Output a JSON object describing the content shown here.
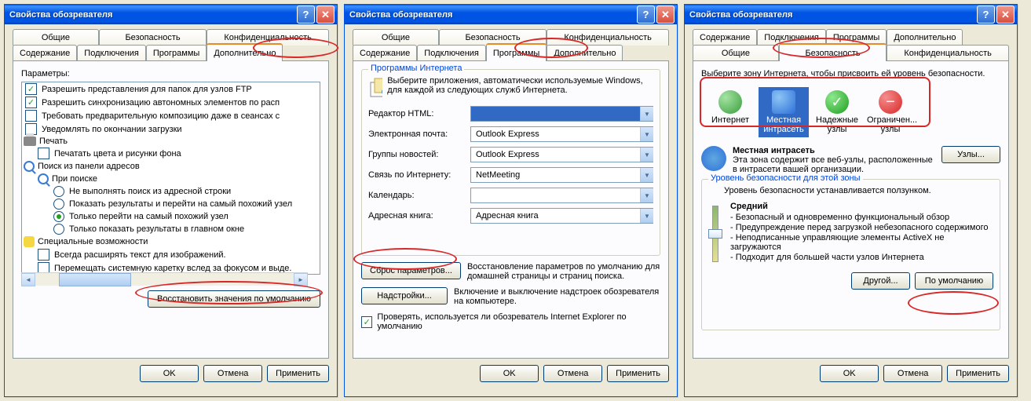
{
  "title": "Свойства обозревателя",
  "tabs": {
    "general": "Общие",
    "security": "Безопасность",
    "privacy": "Конфиденциальность",
    "content": "Содержание",
    "connections": "Подключения",
    "programs": "Программы",
    "advanced": "Дополнительно"
  },
  "buttons": {
    "ok": "OK",
    "cancel": "Отмена",
    "apply": "Применить",
    "restore": "Восстановить значения по умолчанию",
    "reset": "Сброс параметров...",
    "addons": "Надстройки...",
    "sites": "Узлы...",
    "custom": "Другой...",
    "default_level": "По умолчанию"
  },
  "adv": {
    "params_label": "Параметры:",
    "items": {
      "ftp": "Разрешить представления для папок для узлов FTP",
      "sync": "Разрешить синхронизацию автономных элементов по расп",
      "compose": "Требовать предварительную композицию даже в сеансах с",
      "notify": "Уведомлять по окончании загрузки",
      "print_h": "Печать",
      "print_bg": "Печатать цвета и рисунки фона",
      "search_h": "Поиск из панели адресов",
      "on_search": "При поиске",
      "no_search": "Не выполнять поиск из адресной строки",
      "show_goto": "Показать результаты и перейти на самый похожий узел",
      "goto_only": "Только перейти на самый похожий узел",
      "show_main": "Только показать результаты в главном окне",
      "acc_h": "Специальные возможности",
      "expand_alt": "Всегда расширять текст для изображений.",
      "caret": "Перемещать системную каретку вслед за фокусом и выде."
    }
  },
  "prog": {
    "group_title": "Программы Интернета",
    "desc": "Выберите приложения, автоматически используемые Windows, для каждой из следующих служб Интернета.",
    "fields": {
      "html": "Редактор HTML:",
      "mail": "Электронная почта:",
      "news": "Группы новостей:",
      "call": "Связь по Интернету:",
      "cal": "Календарь:",
      "addr": "Адресная книга:"
    },
    "values": {
      "html": "",
      "mail": "Outlook Express",
      "news": "Outlook Express",
      "call": "NetMeeting",
      "cal": "",
      "addr": "Адресная книга"
    },
    "reset_hint": "Восстановление параметров по умолчанию для домашней страницы и страниц поиска.",
    "addons_hint": "Включение и выключение надстроек обозревателя на компьютере.",
    "check_default": "Проверять, используется ли обозреватель Internet Explorer по умолчанию"
  },
  "sec": {
    "hint": "Выберите зону Интернета, чтобы присвоить ей уровень безопасности.",
    "zones": {
      "internet": "Интернет",
      "intranet": "Местная интрасеть",
      "trusted": "Надежные узлы",
      "restricted": "Ограничен... узлы"
    },
    "zone_title": "Местная интрасеть",
    "zone_desc": "Эта зона содержит все веб-узлы, расположенные в интрасети вашей организации.",
    "level_group": "Уровень безопасности для этой зоны",
    "level_hint": "Уровень безопасности устанавливается ползунком.",
    "level_name": "Средний",
    "level_b1": "- Безопасный и одновременно функциональный обзор",
    "level_b2": "- Предупреждение перед загрузкой небезопасного содержимого",
    "level_b3": "- Неподписанные управляющие элементы ActiveX не загружаются",
    "level_b4": "- Подходит для большей части узлов Интернета"
  }
}
